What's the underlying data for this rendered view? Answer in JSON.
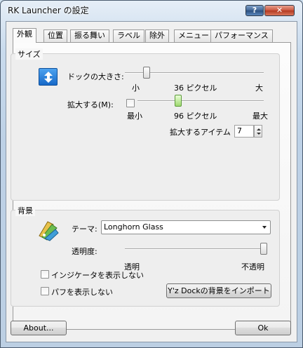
{
  "window": {
    "title": "RK Launcher の設定",
    "help_label": "?",
    "close_label": "✕"
  },
  "tabs": [
    {
      "label": "外観"
    },
    {
      "label": "位置"
    },
    {
      "label": "振る舞い"
    },
    {
      "label": "ラベル"
    },
    {
      "label": "除外"
    },
    {
      "label": "メニュー"
    },
    {
      "label": "パフォーマンス"
    }
  ],
  "size_group": {
    "legend": "サイズ",
    "icon": "resize-icon",
    "dock_size_label": "ドックの大きさ:",
    "dock_size": {
      "min_label": "小",
      "value_label": "36 ピクセル",
      "max_label": "大",
      "value": 36
    },
    "zoom_label": "拡大する(M):",
    "zoom_checked": false,
    "zoom_size": {
      "min_label": "最小",
      "value_label": "96 ピクセル",
      "max_label": "最大",
      "value": 96
    },
    "zoom_items_label": "拡大するアイテム",
    "zoom_items_value": "7"
  },
  "bg_group": {
    "legend": "背景",
    "icon": "theme-palette-icon",
    "theme_label": "テーマ:",
    "theme_value": "Longhorn Glass",
    "opacity_label": "透明度:",
    "opacity": {
      "min_label": "透明",
      "max_label": "不透明",
      "fraction": 1.0
    },
    "hide_indicator_label": "インジケータを表示しない",
    "hide_indicator_checked": false,
    "hide_puff_label": "パフを表示しない",
    "hide_puff_checked": false,
    "import_button": "Y'z Dockの背景をインポート"
  },
  "footer": {
    "about_button": "About...",
    "ok_button": "Ok"
  },
  "colors": {
    "accent": "#1769c8",
    "slider_active": "#9fd86f",
    "close": "#c9553d"
  }
}
